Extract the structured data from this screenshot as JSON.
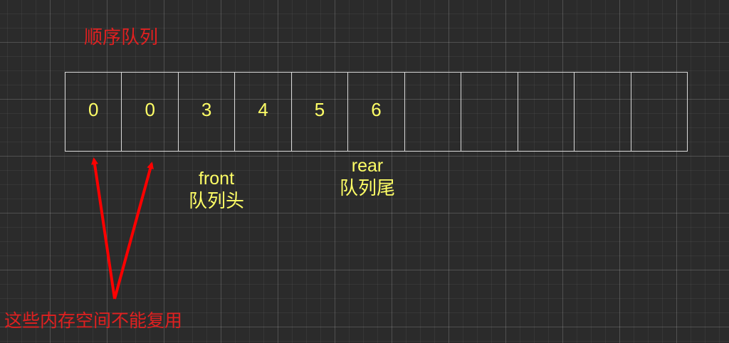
{
  "title": "顺序队列",
  "queue": {
    "cells": [
      "0",
      "0",
      "3",
      "4",
      "5",
      "6",
      "",
      "",
      "",
      "",
      ""
    ]
  },
  "front_pointer": {
    "label_en": "front",
    "label_zh": "队列头"
  },
  "rear_pointer": {
    "label_en": "rear",
    "label_zh": "队列尾"
  },
  "note": "这些内存空间不能复用",
  "colors": {
    "background": "#2b2b2b",
    "grid_line": "#444444",
    "cell_border": "#d9d9d9",
    "value_text": "#ffff66",
    "title_text": "#e02020",
    "arrow": "#ff0000"
  }
}
